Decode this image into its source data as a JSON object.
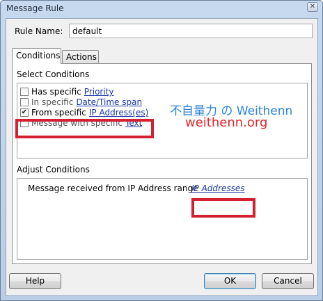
{
  "window": {
    "title": "Message Rule",
    "close_glyph": "✕"
  },
  "rule_name": {
    "label": "Rule Name:",
    "value": "default"
  },
  "tabs": [
    {
      "label": "Conditions",
      "selected": true
    },
    {
      "label": "Actions",
      "selected": false
    }
  ],
  "select_conditions": {
    "label": "Select Conditions",
    "items": [
      {
        "prefix": "Has specific",
        "link": "Priority",
        "checked": false
      },
      {
        "prefix": "In specific",
        "link": "Date/Time span",
        "checked": false
      },
      {
        "prefix": "From specific",
        "link": "IP Address(es)",
        "checked": true
      },
      {
        "prefix": "Message with specific",
        "link": "Text",
        "checked": false
      }
    ]
  },
  "adjust_conditions": {
    "label": "Adjust Conditions",
    "text": "Message received from IP Address range",
    "link": "IP Addresses"
  },
  "watermark": {
    "line1": "不自量力 の Weithenn",
    "line2": "weithenn.org"
  },
  "buttons": {
    "help": "Help",
    "ok": "OK",
    "cancel": "Cancel"
  },
  "colors": {
    "highlight": "#d42030",
    "link": "#1a37a8",
    "watermark_blue": "#2b85d8",
    "watermark_red": "#e0262b"
  },
  "icons": {
    "checkmark": "✔"
  }
}
